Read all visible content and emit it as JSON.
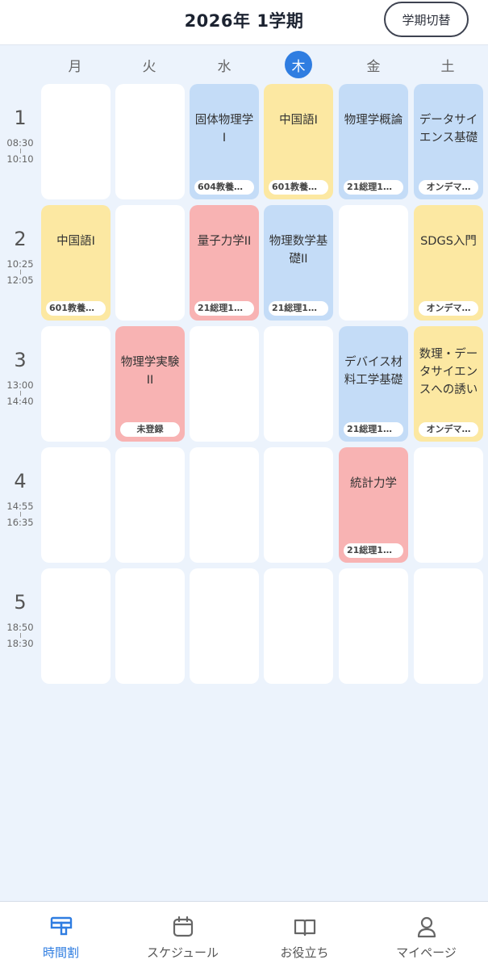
{
  "header": {
    "title": "2026年 1学期",
    "term_switch": "学期切替"
  },
  "days": [
    "月",
    "火",
    "水",
    "木",
    "金",
    "土"
  ],
  "today_index": 3,
  "periods": [
    {
      "num": "1",
      "start": "08:30",
      "end": "10:10"
    },
    {
      "num": "2",
      "start": "10:25",
      "end": "12:05"
    },
    {
      "num": "3",
      "start": "13:00",
      "end": "14:40"
    },
    {
      "num": "4",
      "start": "14:55",
      "end": "16:35"
    },
    {
      "num": "5",
      "start": "18:50",
      "end": "18:30"
    }
  ],
  "colors": {
    "accent": "#2f7de1",
    "blue": "#c4dcf7",
    "yellow": "#fce8a2",
    "red": "#f8b3b3",
    "background": "#ecf3fc"
  },
  "grid": [
    [
      {
        "name": "",
        "room": "",
        "color": "white"
      },
      {
        "name": "",
        "room": "",
        "color": "white"
      },
      {
        "name": "固体物理学\nI",
        "room": "604教養講…",
        "color": "blue"
      },
      {
        "name": "中国語Ⅰ",
        "room": "601教養講…",
        "color": "yellow"
      },
      {
        "name": "物理学概論",
        "room": "21総理1号…",
        "color": "blue"
      },
      {
        "name": "データサイ\nエンス基礎",
        "room": "オンデマ…",
        "color": "blue"
      }
    ],
    [
      {
        "name": "中国語Ⅰ",
        "room": "601教養講…",
        "color": "yellow"
      },
      {
        "name": "",
        "room": "",
        "color": "white"
      },
      {
        "name": "量子力学II",
        "room": "21総理1号…",
        "color": "red"
      },
      {
        "name": "物理数学基\n礎II",
        "room": "21総理1号…",
        "color": "blue"
      },
      {
        "name": "",
        "room": "",
        "color": "white"
      },
      {
        "name": "SDGS入門",
        "room": "オンデマ…",
        "color": "yellow"
      }
    ],
    [
      {
        "name": "",
        "room": "",
        "color": "white"
      },
      {
        "name": "物理学実験\nII",
        "room": "未登録",
        "color": "red"
      },
      {
        "name": "",
        "room": "",
        "color": "white"
      },
      {
        "name": "",
        "room": "",
        "color": "white"
      },
      {
        "name": "デバイス材\n料工学基礎",
        "room": "21総理1号…",
        "color": "blue"
      },
      {
        "name": "数理・デー\nタサイエン\nスへの誘い",
        "room": "オンデマ…",
        "color": "yellow"
      }
    ],
    [
      {
        "name": "",
        "room": "",
        "color": "white"
      },
      {
        "name": "",
        "room": "",
        "color": "white"
      },
      {
        "name": "",
        "room": "",
        "color": "white"
      },
      {
        "name": "",
        "room": "",
        "color": "white"
      },
      {
        "name": "統計力学",
        "room": "21総理1号…",
        "color": "red"
      },
      {
        "name": "",
        "room": "",
        "color": "white"
      }
    ],
    [
      {
        "name": "",
        "room": "",
        "color": "white"
      },
      {
        "name": "",
        "room": "",
        "color": "white"
      },
      {
        "name": "",
        "room": "",
        "color": "white"
      },
      {
        "name": "",
        "room": "",
        "color": "white"
      },
      {
        "name": "",
        "room": "",
        "color": "white"
      },
      {
        "name": "",
        "room": "",
        "color": "white"
      }
    ]
  ],
  "nav": [
    {
      "label": "時間割",
      "icon": "timetable-icon",
      "active": true
    },
    {
      "label": "スケジュール",
      "icon": "calendar-icon",
      "active": false
    },
    {
      "label": "お役立ち",
      "icon": "book-icon",
      "active": false
    },
    {
      "label": "マイページ",
      "icon": "user-icon",
      "active": false
    }
  ]
}
